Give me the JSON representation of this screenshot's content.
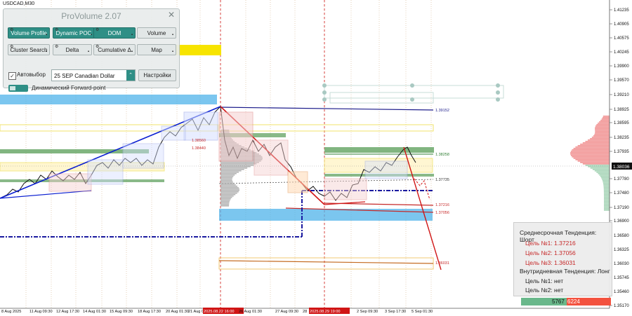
{
  "symbol": "USDCAD,M30",
  "panel": {
    "title": "ProVolume 2.07",
    "close": "✕",
    "buttons": [
      {
        "label": "Volume Profile",
        "style": "teal"
      },
      {
        "label": "Dynamic POC",
        "style": "teal"
      },
      {
        "label": "DOM",
        "style": "teal"
      },
      {
        "label": "Volume",
        "style": "gray"
      },
      {
        "label": "Cluster Search",
        "style": "gray"
      },
      {
        "label": "Delta",
        "style": "gray"
      },
      {
        "label": "Cumulative Δ",
        "style": "gray"
      },
      {
        "label": "Map",
        "style": "gray"
      }
    ],
    "auto_label": "Автовыбор",
    "auto_checked": true,
    "instrument": "25 SEP Canadian Dollar",
    "settings_label": "Настройки",
    "forward_label": "Динамический Forward-point"
  },
  "price_axis": [
    "1.41235",
    "1.40905",
    "1.40575",
    "1.40245",
    "1.39900",
    "1.39570",
    "1.39210",
    "1.38925",
    "1.38595",
    "1.38235",
    "1.37935",
    "1.37780",
    "1.37480",
    "1.37190",
    "1.36900",
    "1.36580",
    "1.36325",
    "1.36030",
    "1.35745",
    "1.35460",
    "1.35170"
  ],
  "current_price": "1.38036",
  "level_labels": [
    {
      "text": "1.39152",
      "color": "#1a1a8a"
    },
    {
      "text": "1.38258",
      "color": "#2e7d32"
    },
    {
      "text": "1.37735",
      "color": "#333333"
    },
    {
      "text": "1.37216",
      "color": "#c62828"
    },
    {
      "text": "1.37056",
      "color": "#c62828"
    },
    {
      "text": "1.36031",
      "color": "#c62828"
    },
    {
      "text": "1.38560",
      "color": "#c62828"
    },
    {
      "text": "1.38440",
      "color": "#c62828"
    }
  ],
  "time_axis": [
    "8 Aug 2025",
    "11 Aug 09:30",
    "12 Aug 17:30",
    "14 Aug 01:30",
    "15 Aug 09:30",
    "18 Aug 17:30",
    "20 Aug 01:30",
    "21 Aug 09:30",
    "2025.08.22 16:00",
    "26 Aug 01:30",
    "27 Aug 09:30",
    "28",
    "2025.08.29 19:00",
    "2 Sep 09:30",
    "3 Sep 17:30",
    "5 Sep 01:30"
  ],
  "trend_box": {
    "short_title": "Среднесрочная Тенденция: Шорт",
    "target1": "Цель №1: 1.37216",
    "target2": "Цель №2: 1.37056",
    "target3": "Цель №3: 1.36031",
    "long_title": "Внутридневная Тенденция: Лонг",
    "long1": "Цель №1: нет",
    "long2": "Цель №2: нет",
    "short_color": "#c62828"
  },
  "volume_bar": {
    "buy": "5767",
    "sell": "6224",
    "buy_color": "#6ab88b",
    "sell_color": "#f3523f"
  },
  "colors": {
    "accent": "#2f8f86",
    "blue_trend": "#0b1fd1",
    "red_trend": "#d01515",
    "sky_zone": "#4fb3ea",
    "yellow_zone": "#f7e400",
    "green_zone": "#5da05a"
  }
}
